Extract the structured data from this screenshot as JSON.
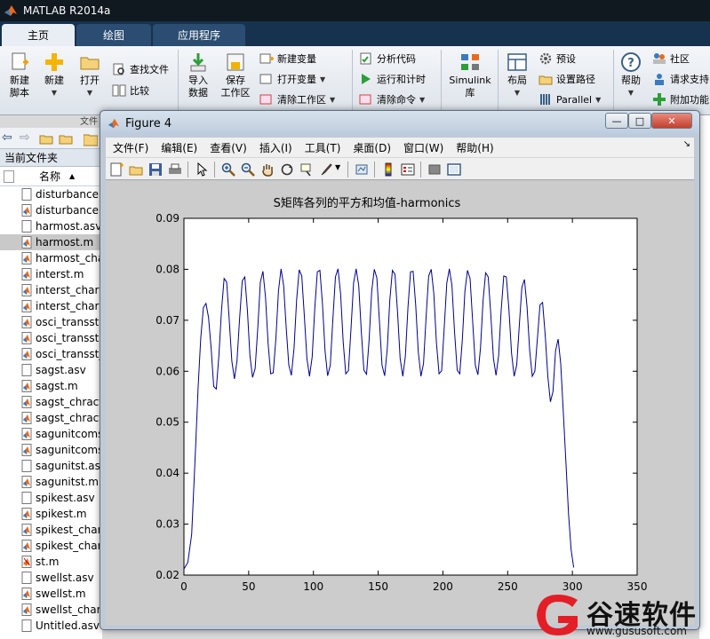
{
  "app": {
    "title": "MATLAB R2014a"
  },
  "tabs": [
    {
      "label": "主页",
      "active": true
    },
    {
      "label": "绘图",
      "active": false
    },
    {
      "label": "应用程序",
      "active": false
    }
  ],
  "ribbon": {
    "new_script": "新建\n脚本",
    "new": "新建",
    "open": "打开",
    "find_files": "查找文件",
    "compare": "比较",
    "section_file": "文件",
    "import_data": "导入\n数据",
    "save_workspace": "保存\n工作区",
    "new_variable": "新建变量",
    "open_variable": "打开变量",
    "clear_workspace": "清除工作区",
    "analyze_code": "分析代码",
    "run_and_time": "运行和计时",
    "clear_commands": "清除命令",
    "simulink": "Simulink\n库",
    "layout": "布局",
    "preferences": "预设",
    "set_path": "设置路径",
    "parallel": "Parallel",
    "help": "帮助",
    "community": "社区",
    "request_support": "请求支持",
    "add_ons": "附加功能"
  },
  "file_browser": {
    "title": "当前文件夹",
    "column_name": "名称",
    "files": [
      {
        "name": "disturbance.asv",
        "type": "asv"
      },
      {
        "name": "disturbance.m",
        "type": "m"
      },
      {
        "name": "harmost.asv",
        "type": "asv"
      },
      {
        "name": "harmost.m",
        "type": "m",
        "selected": true
      },
      {
        "name": "harmost_cha",
        "type": "m"
      },
      {
        "name": "interst.m",
        "type": "m"
      },
      {
        "name": "interst_chara",
        "type": "m"
      },
      {
        "name": "interst_chara",
        "type": "m"
      },
      {
        "name": "osci_transst.",
        "type": "m"
      },
      {
        "name": "osci_transst.",
        "type": "m"
      },
      {
        "name": "osci_transst_",
        "type": "m"
      },
      {
        "name": "sagst.asv",
        "type": "asv"
      },
      {
        "name": "sagst.m",
        "type": "m"
      },
      {
        "name": "sagst_chract",
        "type": "m"
      },
      {
        "name": "sagst_chract",
        "type": "m"
      },
      {
        "name": "sagunitcoms",
        "type": "m"
      },
      {
        "name": "sagunitcoms",
        "type": "m"
      },
      {
        "name": "sagunitst.asv",
        "type": "asv"
      },
      {
        "name": "sagunitst.m",
        "type": "m"
      },
      {
        "name": "spikest.asv",
        "type": "asv"
      },
      {
        "name": "spikest.m",
        "type": "m"
      },
      {
        "name": "spikest_char",
        "type": "m"
      },
      {
        "name": "spikest_char",
        "type": "m"
      },
      {
        "name": "st.m",
        "type": "fig"
      },
      {
        "name": "swellst.asv",
        "type": "asv"
      },
      {
        "name": "swellst.m",
        "type": "m"
      },
      {
        "name": "swellst_chara",
        "type": "m"
      },
      {
        "name": "Untitled.asv",
        "type": "asv"
      }
    ]
  },
  "figure": {
    "title": "Figure 4",
    "menu": [
      "文件(F)",
      "编辑(E)",
      "查看(V)",
      "插入(I)",
      "工具(T)",
      "桌面(D)",
      "窗口(W)",
      "帮助(H)"
    ],
    "toolbar_icons": [
      "new-figure-icon",
      "open-file-icon",
      "save-icon",
      "print-icon",
      "pointer-icon",
      "zoom-in-icon",
      "zoom-out-icon",
      "pan-hand-icon",
      "rotate-3d-icon",
      "data-cursor-icon",
      "brush-icon",
      "link-plot-icon",
      "colorbar-icon",
      "legend-icon",
      "hide-plot-tools-icon",
      "show-plot-tools-icon"
    ]
  },
  "chart_data": {
    "type": "line",
    "title": "S矩阵各列的平方和均值-harmonics",
    "xlabel": "",
    "ylabel": "",
    "xlim": [
      0,
      350
    ],
    "ylim": [
      0.02,
      0.09
    ],
    "xticks": [
      0,
      50,
      100,
      150,
      200,
      250,
      300,
      350
    ],
    "yticks": [
      "0.02",
      "0.03",
      "0.04",
      "0.05",
      "0.06",
      "0.07",
      "0.08",
      "0.09"
    ],
    "grid": false,
    "line_color": "#00008b",
    "series": [
      {
        "x": [
          0,
          3,
          6,
          9,
          11,
          13,
          15,
          17,
          19,
          21,
          23,
          25,
          27,
          29,
          31,
          33,
          35,
          37,
          39,
          41,
          43,
          45,
          47,
          49,
          51,
          53,
          55,
          57,
          59,
          61,
          63,
          65,
          67,
          69,
          71,
          73,
          75,
          77,
          79,
          81,
          83,
          85,
          87,
          89,
          91,
          93,
          95,
          97,
          99,
          101,
          103,
          105,
          107,
          109,
          111,
          113,
          115,
          117,
          119,
          121,
          123,
          125,
          127,
          129,
          131,
          133,
          135,
          137,
          139,
          141,
          143,
          145,
          147,
          149,
          151,
          153,
          155,
          157,
          159,
          161,
          163,
          165,
          167,
          169,
          171,
          173,
          175,
          177,
          179,
          181,
          183,
          185,
          187,
          189,
          191,
          193,
          195,
          197,
          199,
          201,
          203,
          205,
          207,
          209,
          211,
          213,
          215,
          217,
          219,
          221,
          223,
          225,
          227,
          229,
          231,
          233,
          235,
          237,
          239,
          241,
          243,
          245,
          247,
          249,
          251,
          253,
          255,
          257,
          259,
          261,
          263,
          265,
          267,
          269,
          271,
          273,
          275,
          277,
          279,
          281,
          283,
          285,
          287,
          289,
          291,
          293,
          295,
          297,
          299,
          301
        ],
        "y": [
          0.0212,
          0.0225,
          0.028,
          0.045,
          0.057,
          0.0665,
          0.0725,
          0.0733,
          0.0705,
          0.0645,
          0.057,
          0.0565,
          0.063,
          0.072,
          0.0782,
          0.0775,
          0.07,
          0.062,
          0.0585,
          0.062,
          0.0705,
          0.0777,
          0.0785,
          0.072,
          0.063,
          0.0588,
          0.0605,
          0.0685,
          0.0775,
          0.0796,
          0.0745,
          0.0655,
          0.0595,
          0.0597,
          0.0665,
          0.0758,
          0.0801,
          0.0768,
          0.0685,
          0.0612,
          0.0592,
          0.0645,
          0.074,
          0.0799,
          0.0787,
          0.0708,
          0.0625,
          0.059,
          0.0628,
          0.0722,
          0.0795,
          0.0798,
          0.0732,
          0.064,
          0.0591,
          0.0612,
          0.0702,
          0.0785,
          0.0801,
          0.0752,
          0.0658,
          0.0595,
          0.0601,
          0.0683,
          0.0773,
          0.0801,
          0.0768,
          0.0678,
          0.0602,
          0.0594,
          0.0662,
          0.0757,
          0.08,
          0.0783,
          0.0698,
          0.0612,
          0.0591,
          0.0644,
          0.074,
          0.0798,
          0.079,
          0.0715,
          0.0625,
          0.059,
          0.063,
          0.0725,
          0.0795,
          0.0796,
          0.073,
          0.0638,
          0.059,
          0.0615,
          0.0706,
          0.0787,
          0.08,
          0.0752,
          0.0657,
          0.0595,
          0.0601,
          0.0685,
          0.0773,
          0.0801,
          0.0768,
          0.0678,
          0.0602,
          0.0595,
          0.0662,
          0.0757,
          0.0798,
          0.0782,
          0.0698,
          0.0612,
          0.0593,
          0.0645,
          0.0738,
          0.0793,
          0.0785,
          0.0712,
          0.0625,
          0.0592,
          0.063,
          0.072,
          0.0787,
          0.0785,
          0.0722,
          0.0635,
          0.059,
          0.0612,
          0.069,
          0.0765,
          0.078,
          0.0727,
          0.064,
          0.059,
          0.06,
          0.0665,
          0.073,
          0.0735,
          0.0672,
          0.059,
          0.054,
          0.056,
          0.064,
          0.0663,
          0.0615,
          0.052,
          0.042,
          0.032,
          0.025,
          0.0215
        ]
      }
    ]
  },
  "watermark": {
    "brand": "谷速软件",
    "url": "www.gususoft.com"
  }
}
